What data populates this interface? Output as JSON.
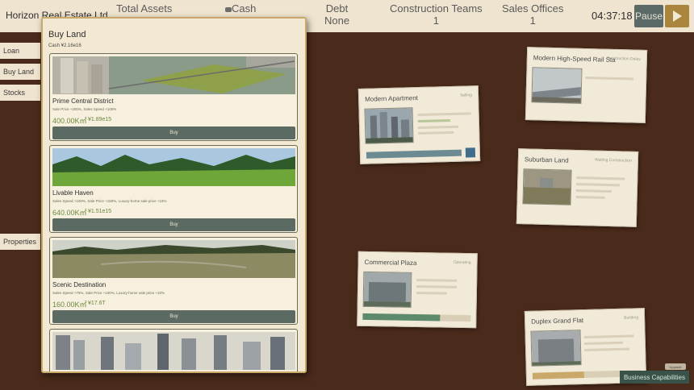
{
  "topbar": {
    "company": "Horizon Real Estate Ltd.",
    "total_assets_label": "Total Assets",
    "cash_label": "Cash",
    "debt_label": "Debt",
    "debt_value": "None",
    "construction_label": "Construction Teams",
    "construction_value": "1",
    "sales_label": "Sales Offices",
    "sales_value": "1",
    "clock": "04:37:18",
    "pause_label": "Pause"
  },
  "nav": {
    "loan": "Loan",
    "buy_land": "Buy Land",
    "stocks": "Stocks",
    "properties": "Properties"
  },
  "modal": {
    "title": "Buy Land",
    "cash": "Cash ¥2.16e16",
    "lands": [
      {
        "name": "Prime Central District",
        "desc": "Sale Price +200%, Sales Speed +100%",
        "area": "400.00K㎡",
        "price": "¥1.89e15",
        "buy": "Buy"
      },
      {
        "name": "Livable Haven",
        "desc": "Sales Speed +100%, Sale Price +150%, Luxury-home sale price +15%",
        "area": "640.00K㎡",
        "price": "¥1.51e15",
        "buy": "Buy"
      },
      {
        "name": "Scenic Destination",
        "desc": "Sales Speed +75%, Sale Price +100%, Luxury-home sale price +10%",
        "area": "160.00K㎡",
        "price": "¥17.6T",
        "buy": "Buy"
      }
    ]
  },
  "board": {
    "cards": [
      {
        "title": "Modern Apartment",
        "status": "Selling"
      },
      {
        "title": "Modern High-Speed Rail Sta",
        "status": "Construction Delay"
      },
      {
        "title": "Suburban Land",
        "status": "Waiting Construction"
      },
      {
        "title": "Commercial Plaza",
        "status": "Operating"
      },
      {
        "title": "Duplex Grand Flat",
        "status": "Building"
      }
    ]
  },
  "business": {
    "label": "Business Capabilities",
    "badge": "Upgrade"
  },
  "colors": {
    "background": "#4a2a1a",
    "panel": "#efe4cf",
    "accent_green": "#6b8a3f",
    "button": "#5b6a62",
    "gold": "#a9853e"
  }
}
